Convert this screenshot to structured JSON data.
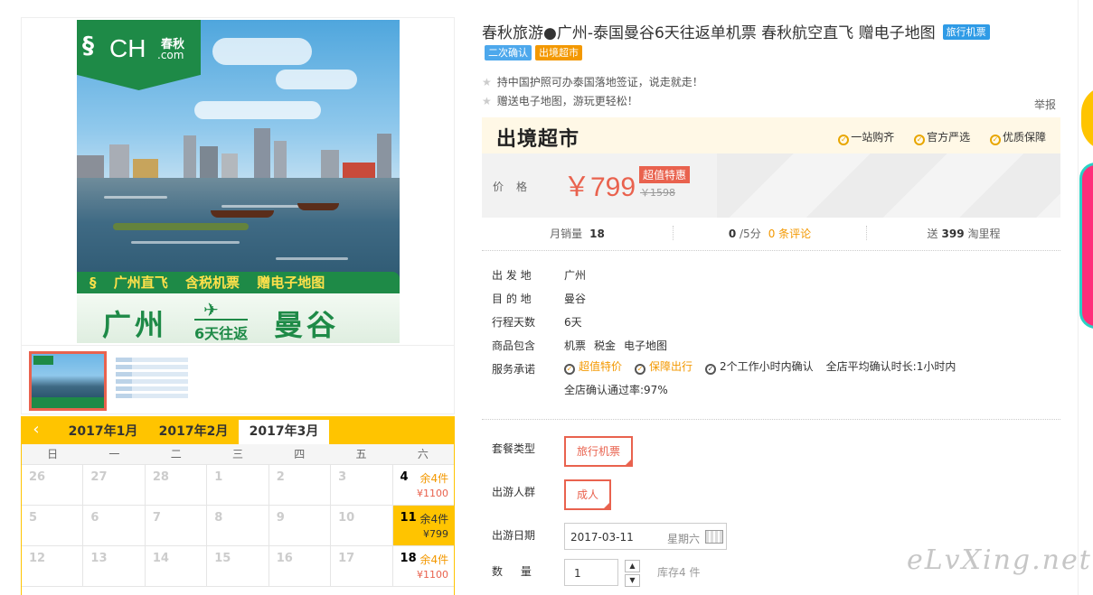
{
  "gallery": {
    "logo_text": "CH",
    "logo_cn": "春秋",
    "logo_com": ".com",
    "banner_line1": [
      "广州直飞",
      "含税机票",
      "赠电子地图"
    ],
    "banner_city_from": "广州",
    "banner_trip": "6天往返",
    "banner_city_to": "曼谷"
  },
  "calendar": {
    "prev_icon": "chevron-left-icon",
    "months": [
      "2017年1月",
      "2017年2月",
      "2017年3月"
    ],
    "active_month": "2017年3月",
    "weekdays": [
      "日",
      "一",
      "二",
      "三",
      "四",
      "五",
      "六"
    ],
    "rows": [
      [
        {
          "d": "26"
        },
        {
          "d": "27"
        },
        {
          "d": "28"
        },
        {
          "d": "1"
        },
        {
          "d": "2"
        },
        {
          "d": "3"
        },
        {
          "d": "4",
          "stock": "余4件",
          "price": "¥1100"
        }
      ],
      [
        {
          "d": "5"
        },
        {
          "d": "6"
        },
        {
          "d": "7"
        },
        {
          "d": "8"
        },
        {
          "d": "9"
        },
        {
          "d": "10"
        },
        {
          "d": "11",
          "stock": "余4件",
          "price": "¥799",
          "selected": true
        }
      ],
      [
        {
          "d": "12"
        },
        {
          "d": "13"
        },
        {
          "d": "14"
        },
        {
          "d": "15"
        },
        {
          "d": "16"
        },
        {
          "d": "17"
        },
        {
          "d": "18",
          "stock": "余4件",
          "price": "¥1100"
        }
      ]
    ]
  },
  "product": {
    "title": "春秋旅游●广州-泰国曼谷6天往返单机票 春秋航空直飞 赠电子地图",
    "tag_title": "旅行机票",
    "tags": [
      "二次确认",
      "出境超市"
    ],
    "features": [
      "持中国护照可办泰国落地签证，说走就走！",
      "赠送电子地图，游玩更轻松！"
    ],
    "report": "举报"
  },
  "pricebox": {
    "logo": "出境超市",
    "badges": [
      "一站购齐",
      "官方严选",
      "优质保障"
    ],
    "price_label": "价格",
    "price": "￥799",
    "special": "超值特惠",
    "original": "￥1598"
  },
  "stats": {
    "monthly_label": "月销量",
    "monthly_value": "18",
    "score": "0",
    "score_suffix": "/5分",
    "reviews": "0 条评论",
    "points_prefix": "送",
    "points": "399",
    "points_suffix": "淘里程"
  },
  "attrs": {
    "from_label": "出 发 地",
    "from": "广州",
    "to_label": "目 的 地",
    "to": "曼谷",
    "days_label": "行程天数",
    "days": "6天",
    "include_label": "商品包含",
    "includes": [
      "机票",
      "税金",
      "电子地图"
    ],
    "service_label": "服务承诺",
    "services": [
      "超值特价",
      "保障出行",
      "2个工作小时内确认"
    ],
    "service_extra": [
      "全店平均确认时长:1小时内",
      "全店确认通过率:97%"
    ]
  },
  "options": {
    "package_label": "套餐类型",
    "package_value": "旅行机票",
    "crowd_label": "出游人群",
    "crowd_value": "成人",
    "date_label": "出游日期",
    "date_value": "2017-03-11",
    "date_weekday": "星期六",
    "qty_label": "数 量",
    "qty_value": "1",
    "stock": "库存4 件"
  },
  "watermark": "eLvXing.net",
  "colors": {
    "accent": "#e9624e",
    "yellow": "#ffc400",
    "green": "#1e8a47",
    "orange": "#f39800"
  }
}
